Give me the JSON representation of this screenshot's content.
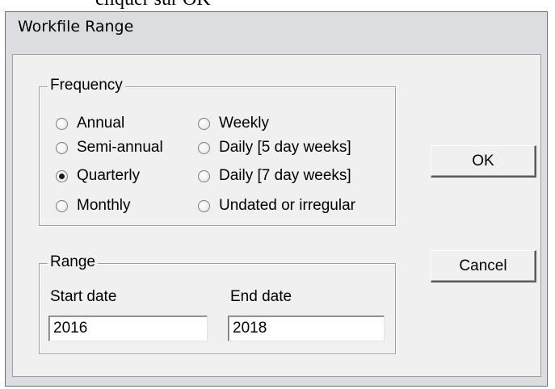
{
  "top_text": "cliquer sur OK",
  "window": {
    "title": "Workfile Range"
  },
  "frequency": {
    "legend": "Frequency",
    "options": [
      {
        "label": "Annual",
        "checked": false
      },
      {
        "label": "Weekly",
        "checked": false
      },
      {
        "label": "Semi-annual",
        "checked": false
      },
      {
        "label": "Daily [5 day weeks]",
        "checked": false
      },
      {
        "label": "Quarterly",
        "checked": true
      },
      {
        "label": "Daily [7 day weeks]",
        "checked": false
      },
      {
        "label": "Monthly",
        "checked": false
      },
      {
        "label": "Undated or irregular",
        "checked": false
      }
    ]
  },
  "range": {
    "legend": "Range",
    "start_label": "Start date",
    "start_value": "2016",
    "end_label": "End date",
    "end_value": "2018"
  },
  "buttons": {
    "ok": "OK",
    "cancel": "Cancel"
  }
}
